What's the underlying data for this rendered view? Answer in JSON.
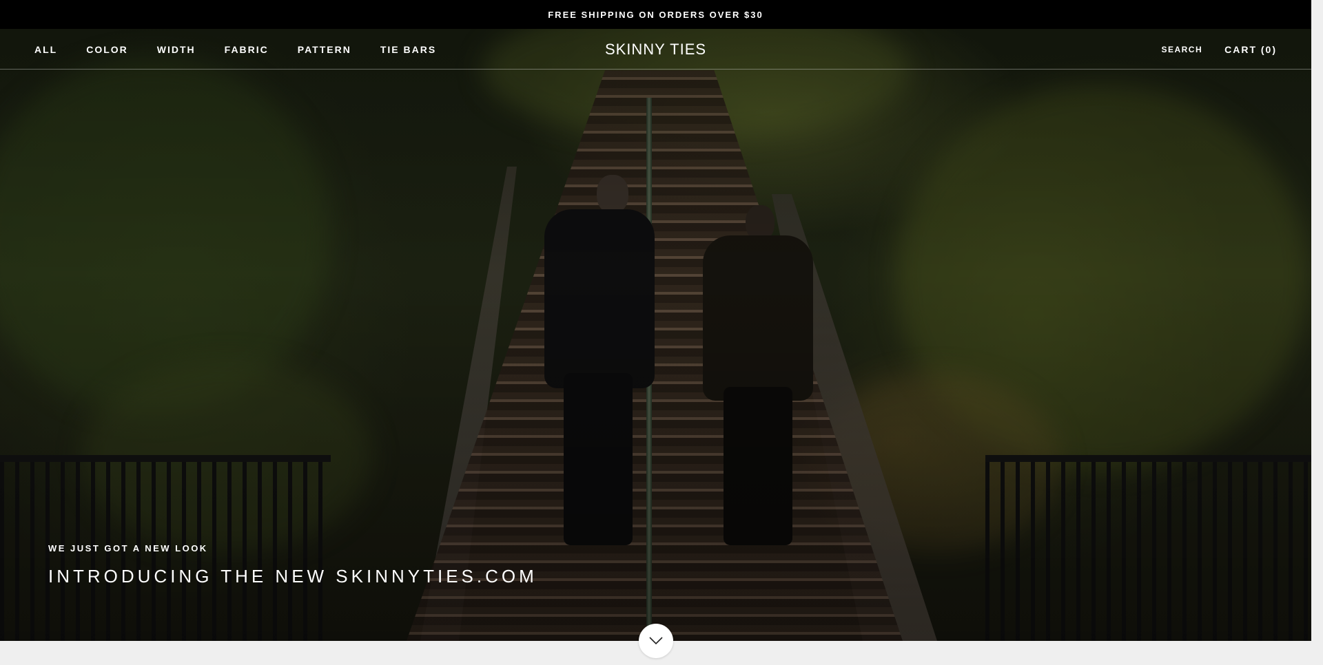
{
  "announcement": {
    "text": "FREE SHIPPING ON ORDERS OVER $30"
  },
  "header": {
    "nav": [
      {
        "label": "ALL"
      },
      {
        "label": "COLOR"
      },
      {
        "label": "WIDTH"
      },
      {
        "label": "FABRIC"
      },
      {
        "label": "PATTERN"
      },
      {
        "label": "TIE BARS"
      }
    ],
    "logo": "SKINNY TIES",
    "search_label": "SEARCH",
    "cart_label": "CART (0)"
  },
  "hero": {
    "eyebrow": "WE JUST GOT A NEW LOOK",
    "headline": "INTRODUCING THE NEW SKINNYTIES.COM",
    "scroll_icon": "chevron-down-icon"
  },
  "colors": {
    "announcement_bg": "#000000",
    "text_on_dark": "#ffffff",
    "page_bg": "#efefef"
  }
}
